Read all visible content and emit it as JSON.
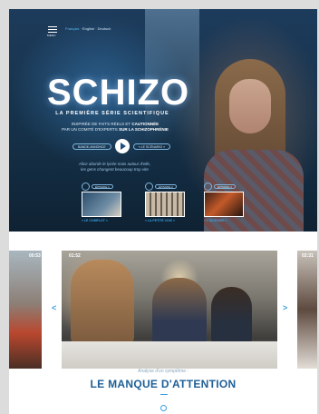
{
  "header": {
    "menu_label": "MENU",
    "languages": [
      "Français",
      "English",
      "Deutsch"
    ],
    "language_separator": "·"
  },
  "hero": {
    "title": "SCHIZO",
    "subtitle": "LA PREMIÈRE SÉRIE SCIENTIFIQUE",
    "intro_line1_prefix": "INSPIRÉE DE FAITS RÉELS ET",
    "intro_line1_highlight": "CAUTIONNÉE",
    "intro_line2_prefix": "PAR UN COMITÉ D'EXPERTS",
    "intro_line2_highlight": "SUR LA SCHIZOPHRÉNIE",
    "trailer_label": "BANDE-ANNONCE",
    "episode_label": "« LE SCÉNARIO »",
    "tagline_line1": "Alice aborde le lycée mais autour d'elle,",
    "tagline_line2": "les gens changent beaucoup trop vite"
  },
  "episodes": [
    {
      "category": "ÉPISODE 1",
      "caption": "« LE COMPLOT »"
    },
    {
      "category": "ÉPISODE 2",
      "caption": "« LA PETITE VOIX »"
    },
    {
      "category": "ÉPISODE 3",
      "caption": "« L'INCENDIE »"
    }
  ],
  "carousel": {
    "timecodes": [
      "00:53",
      "01:52",
      "02:31"
    ],
    "prev": "<",
    "next": ">"
  },
  "section": {
    "intro": "Analyse d'un symptôme :",
    "title": "LE MANQUE D'ATTENTION"
  },
  "colors": {
    "accent": "#3aa0e0",
    "title_blue": "#1d5f96",
    "hero_dark": "#153149"
  }
}
